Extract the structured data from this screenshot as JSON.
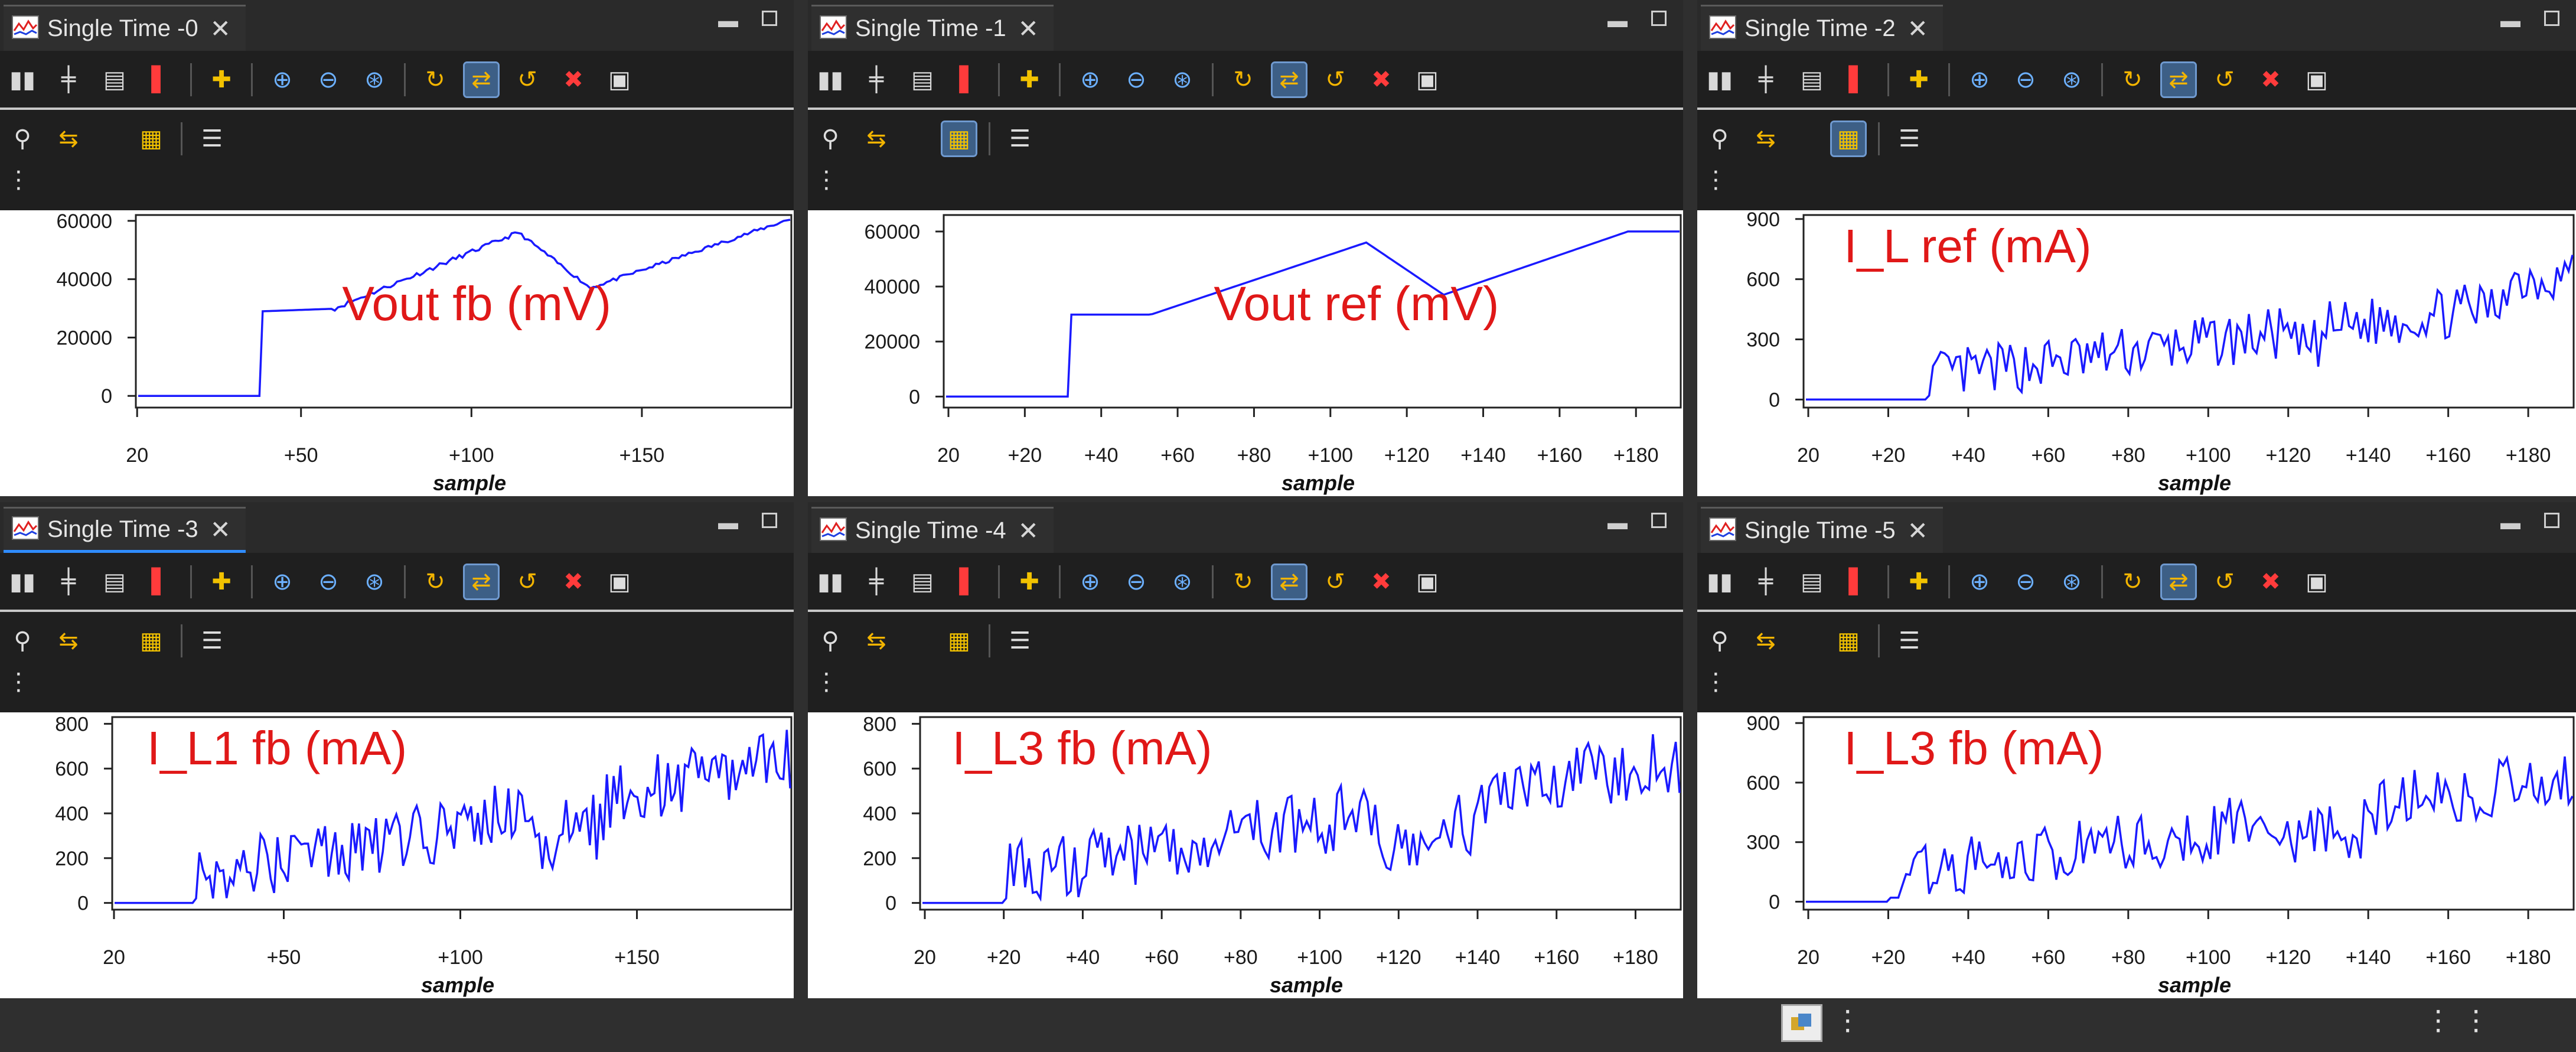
{
  "panels": [
    {
      "tab_title": "Single Time -0",
      "overlay": "Vout fb (mV)",
      "x_axis_label": "sample",
      "x_ticks": [
        "20",
        "+50",
        "+100",
        "+150"
      ],
      "y_ticks": [
        "60000",
        "40000",
        "20000",
        "0"
      ]
    },
    {
      "tab_title": "Single Time -1",
      "overlay": "Vout ref (mV)",
      "x_axis_label": "sample",
      "x_ticks": [
        "20",
        "+20",
        "+40",
        "+60",
        "+80",
        "+100",
        "+120",
        "+140",
        "+160",
        "+180"
      ],
      "y_ticks": [
        "60000",
        "40000",
        "20000",
        "0"
      ]
    },
    {
      "tab_title": "Single Time -2",
      "overlay": "I_L ref (mA)",
      "x_axis_label": "sample",
      "x_ticks": [
        "20",
        "+20",
        "+40",
        "+60",
        "+80",
        "+100",
        "+120",
        "+140",
        "+160",
        "+180"
      ],
      "y_ticks": [
        "900",
        "600",
        "300",
        "0"
      ]
    },
    {
      "tab_title": "Single Time -3",
      "overlay": "I_L1 fb (mA)",
      "x_axis_label": "sample",
      "x_ticks": [
        "20",
        "+50",
        "+100",
        "+150"
      ],
      "y_ticks": [
        "800",
        "600",
        "400",
        "200",
        "0"
      ]
    },
    {
      "tab_title": "Single Time -4",
      "overlay": "I_L3 fb (mA)",
      "x_axis_label": "sample",
      "x_ticks": [
        "20",
        "+20",
        "+40",
        "+60",
        "+80",
        "+100",
        "+120",
        "+140",
        "+160",
        "+180"
      ],
      "y_ticks": [
        "800",
        "600",
        "400",
        "200",
        "0"
      ]
    },
    {
      "tab_title": "Single Time -5",
      "overlay": "I_L3 fb (mA)",
      "x_axis_label": "sample",
      "x_ticks": [
        "20",
        "+20",
        "+40",
        "+60",
        "+80",
        "+100",
        "+120",
        "+140",
        "+160",
        "+180"
      ],
      "y_ticks": [
        "900",
        "600",
        "300",
        "0"
      ]
    }
  ],
  "toolbar_icons": [
    "columns-icon",
    "crosshair-icon",
    "fit-icon",
    "marker-icon",
    "add-icon",
    "zoom-in-icon",
    "zoom-out-icon",
    "zoom-reset-icon",
    "sync-icon",
    "lock-sync-icon",
    "refresh-icon",
    "delete-icon",
    "export-icon"
  ],
  "toolbar2_icons": [
    "binoculars-icon",
    "swap-icon",
    "locked-legend-icon",
    "list-icon"
  ],
  "colors": {
    "series": "#1a1aff",
    "overlay": "#e01818",
    "accent": "#2f8cff"
  }
}
